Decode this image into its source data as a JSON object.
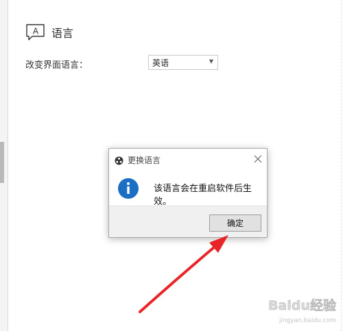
{
  "section": {
    "title": "语言"
  },
  "language_setting": {
    "label": "改变界面语言：",
    "selected": "英语"
  },
  "dialog": {
    "title": "更换语言",
    "message": "该语言会在重启软件后生效。",
    "ok_label": "确定"
  },
  "watermark": {
    "brand": "Baidu经验",
    "url": "jingyan.baidu.com"
  },
  "colors": {
    "info_blue": "#1a6fc4",
    "annotation_red": "#e8262a",
    "dialog_footer": "#f0f0f0"
  }
}
